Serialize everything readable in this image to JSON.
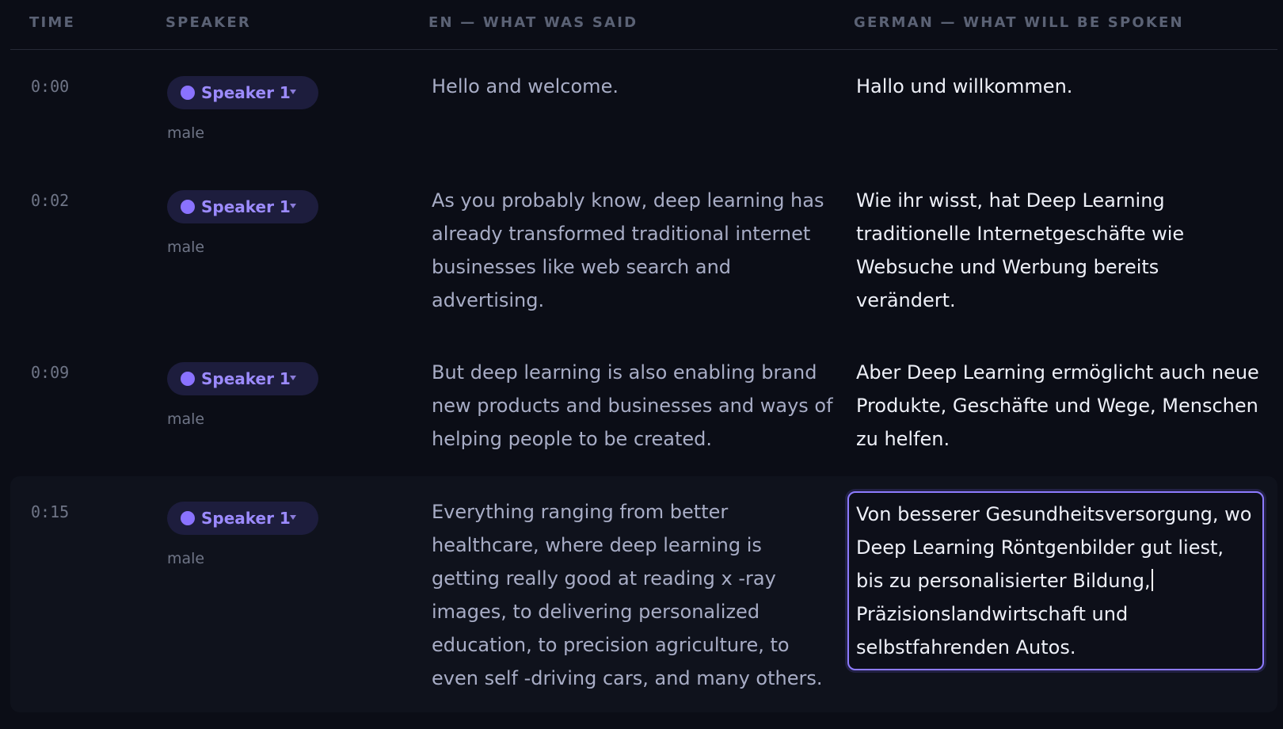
{
  "columns": {
    "time": "TIME",
    "speaker": "SPEAKER",
    "source": "EN — WHAT WAS SAID",
    "target": "GERMAN — WHAT WILL BE SPOKEN"
  },
  "rows": [
    {
      "time": "0:00",
      "speaker": "Speaker 1",
      "gender": "male",
      "source": "Hello and welcome.",
      "target": "Hallo und willkommen."
    },
    {
      "time": "0:02",
      "speaker": "Speaker 1",
      "gender": "male",
      "source": "As you probably know, deep learning has already transformed traditional internet businesses like web search and advertising.",
      "target": "Wie ihr wisst, hat Deep Learning traditionelle Internetgeschäfte wie Websuche und Werbung bereits verändert."
    },
    {
      "time": "0:09",
      "speaker": "Speaker 1",
      "gender": "male",
      "source": "But deep learning is also enabling brand new products and businesses and ways of helping people to be created.",
      "target": "Aber Deep Learning ermöglicht auch neue Produkte, Geschäfte und Wege, Menschen zu helfen."
    },
    {
      "time": "0:15",
      "speaker": "Speaker 1",
      "gender": "male",
      "source": "Everything ranging from better healthcare, where deep learning is getting really good at reading x -ray images, to delivering personalized education, to precision agriculture, to even self -driving cars, and many others.",
      "target_before_cursor": "Von besserer Gesundheitsversorgung, wo Deep Learning Röntgenbilder gut liest, bis zu personalisierter Bildung,",
      "target_after_cursor": " Präzisionslandwirtschaft und selbstfahrenden Autos."
    }
  ],
  "colors": {
    "background": "#0b0d16",
    "accent": "#8a72ff",
    "chip_background": "#1d1d3d",
    "editor_border": "#8d7bff"
  }
}
